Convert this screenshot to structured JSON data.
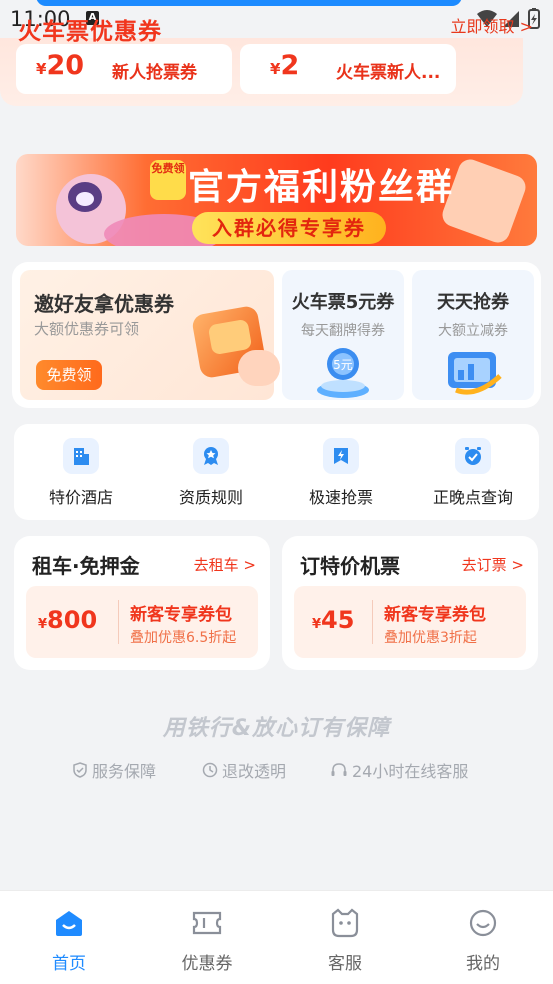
{
  "status_bar": {
    "time": "11:00",
    "notif_letter": "A"
  },
  "train_coupons": {
    "title": "火车票优惠券",
    "link": "立即领取 >",
    "items": [
      {
        "currency": "¥",
        "amount": "20",
        "name": "新人抢票券"
      },
      {
        "currency": "¥",
        "amount": "2",
        "name": "火车票新人..."
      }
    ]
  },
  "banner": {
    "ribbon": "免费领",
    "main": "官方福利粉丝群",
    "pill": "入群必得专享券"
  },
  "promo": {
    "invite_title": "邀好友拿优惠券",
    "invite_sub": "大额优惠券可领",
    "invite_btn": "免费领",
    "card2_title": "火车票5元券",
    "card2_sub": "每天翻牌得券",
    "card3_title": "天天抢券",
    "card3_sub": "大额立减券"
  },
  "services": [
    {
      "label": "特价酒店",
      "icon": "hotel-icon"
    },
    {
      "label": "资质规则",
      "icon": "badge-icon"
    },
    {
      "label": "极速抢票",
      "icon": "lightning-ticket-icon"
    },
    {
      "label": "正晚点查询",
      "icon": "clock-icon"
    }
  ],
  "car_rental": {
    "title": "租车·免押金",
    "link": "去租车 >",
    "currency": "¥",
    "amount": "800",
    "name": "新客专享券包",
    "desc": "叠加优惠6.5折起"
  },
  "flight": {
    "title": "订特价机票",
    "link": "去订票 >",
    "currency": "¥",
    "amount": "45",
    "name": "新客专享券包",
    "desc": "叠加优惠3折起"
  },
  "guarantee": {
    "slogan": "用铁行&放心订有保障",
    "items": [
      "服务保障",
      "退改透明",
      "24小时在线客服"
    ]
  },
  "tabs": [
    {
      "label": "首页",
      "icon": "home-icon",
      "active": true
    },
    {
      "label": "优惠券",
      "icon": "coupon-icon",
      "active": false
    },
    {
      "label": "客服",
      "icon": "service-icon",
      "active": false
    },
    {
      "label": "我的",
      "icon": "profile-icon",
      "active": false
    }
  ],
  "colors": {
    "accent_red": "#f0361d",
    "accent_blue": "#1f8bff"
  }
}
